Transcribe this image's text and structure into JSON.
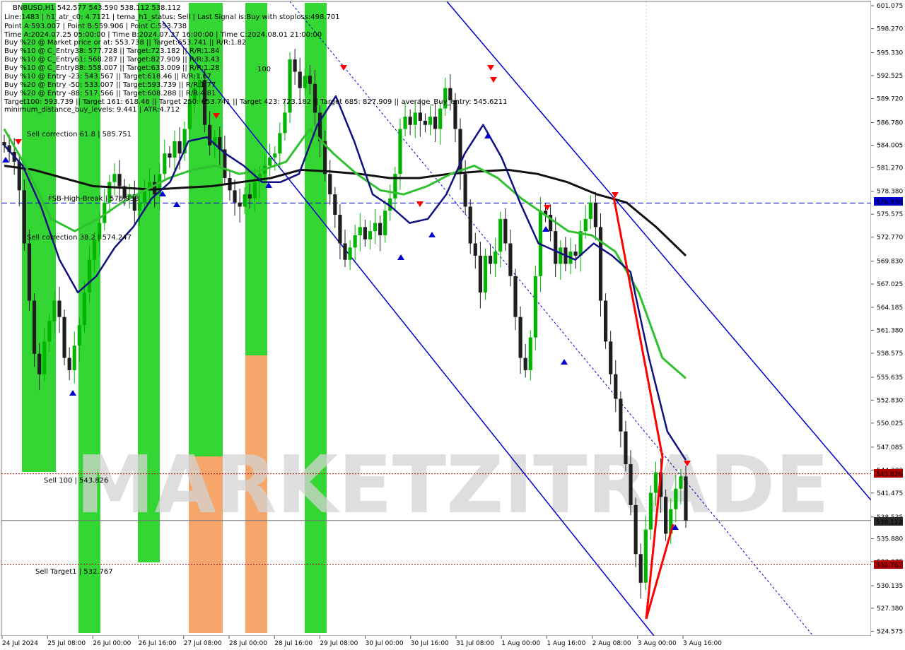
{
  "header": {
    "line1": "BNBUSD,H1  542.577 543.590 538.112 538.112",
    "line2": "Line:1483 | h1_atr_c0: 4.7121 | tema_h1_status: Sell | Last Signal is:Buy with stoploss:498.701",
    "line3": "Point A:593.007 | Point B:559.906 | Point C:553.738",
    "line4": "Time A:2024.07.25 05:00:00 | Time B:2024.07.27 16:00:00 | Time C:2024.08.01 21:00:00",
    "line5": "Buy %20 @ Market price or at: 553.738 || Target:653.741 || R/R:1.82",
    "line6": "Buy %10 @ C_Entry38: 577.728 || Target:723.182 || R/R:1.84",
    "line7": "Buy %10 @ C_Entry61: 568.287 || Target:827.909 || R/R:3.43",
    "line8": "Buy %10 @ C_Entry88: 558.007 || Target:633.009 || R/R:1.28",
    "line9": "Buy %10 @ Entry -23: 543.567 || Target:618.46 || R/R:1.67",
    "line10": "Buy %20 @ Entry -50: 533.007 || Target:593.739 || R/R:1.77",
    "line11": "Buy %20 @ Entry -88: 517.566 || Target:608.288 || R/R:4.81",
    "line12": "Target100: 593.739 || Target 161: 618.46 || Target 250: 653.741 || Target 423: 723.182 || Target 685: 827.909 || average_Buy_entry: 545.6211",
    "line13": "minimum_distance_buy_levels: 9.441 | ATR:4.712"
  },
  "labels": {
    "sell_correction_618": "Sell correction 61.8 | 585.751",
    "sell_correction_382": "Sell correction 38.2 | 574.247",
    "fsb_high": "FSB-High-Break | 576.938",
    "sell_100": "Sell 100 | 543.826",
    "sell_target1": "Sell Target1 | 532.767",
    "marker_100": "100",
    "watermark": "MARKETZITRADE"
  },
  "price_badges": {
    "fsb": "576.938",
    "sell100": "543.826",
    "current": "538.112",
    "target": "532.767"
  },
  "colors": {
    "up_bar": "#00b400",
    "down_bar": "#1e1e1e",
    "green_band": "#33d633",
    "orange_band": "#f5a66a",
    "blue_line": "#0000d0",
    "ma_navy": "#101080",
    "ma_green": "#30c030",
    "ma_black": "#101010",
    "red_line": "#ff0000",
    "dashed_red": "#b00000",
    "orange_dash": "#ff7f27"
  },
  "chart_data": {
    "type": "candlestick",
    "symbol": "BNBUSD",
    "timeframe": "H1",
    "y_axis": {
      "range": [
        524.0,
        601.6
      ],
      "ticks": [
        "601.075",
        "598.270",
        "595.330",
        "592.525",
        "589.720",
        "586.780",
        "584.005",
        "581.270",
        "578.380",
        "575.575",
        "572.770",
        "569.830",
        "567.025",
        "564.185",
        "561.380",
        "558.575",
        "555.635",
        "552.830",
        "550.025",
        "547.085",
        "544.280",
        "541.475",
        "538.535",
        "535.880",
        "533.075",
        "530.135",
        "527.380",
        "524.575"
      ]
    },
    "x_axis": {
      "labels": [
        "24 Jul 2024",
        "25 Jul 08:00",
        "26 Jul 00:00",
        "26 Jul 16:00",
        "27 Jul 08:00",
        "28 Jul 00:00",
        "28 Jul 16:00",
        "29 Jul 08:00",
        "30 Jul 00:00",
        "30 Jul 16:00",
        "31 Jul 08:00",
        "1 Aug 00:00",
        "1 Aug 16:00",
        "2 Aug 08:00",
        "3 Aug 00:00",
        "3 Aug 16:00"
      ]
    },
    "levels": [
      {
        "name": "FSB-High-Break",
        "value": 576.938,
        "style": "dashed-blue"
      },
      {
        "name": "Sell 100",
        "value": 543.826,
        "style": "dotted-red"
      },
      {
        "name": "Current",
        "value": 538.112,
        "style": "solid-gray"
      },
      {
        "name": "Sell Target1",
        "value": 532.767,
        "style": "dotted-red"
      }
    ],
    "close_path": [
      584.0,
      583.2,
      582.0,
      578.5,
      572.0,
      565.0,
      558.5,
      556.0,
      560.0,
      562.5,
      565.0,
      563.0,
      558.0,
      556.5,
      559.5,
      562.0,
      566.0,
      570.0,
      572.5,
      574.5,
      577.0,
      579.5,
      580.5,
      579.0,
      577.5,
      578.0,
      576.0,
      577.0,
      578.5,
      579.5,
      578.0,
      580.5,
      583.0,
      582.5,
      584.5,
      583.0,
      586.0,
      589.5,
      591.0,
      592.0,
      586.5,
      584.0,
      585.0,
      583.5,
      580.0,
      578.5,
      577.0,
      576.5,
      578.0,
      577.5,
      579.5,
      580.5,
      581.5,
      582.5,
      583.0,
      585.5,
      588.0,
      594.5,
      593.0,
      591.0,
      592.5,
      591.5,
      588.0,
      584.5,
      580.5,
      578.0,
      575.5,
      572.0,
      570.0,
      571.5,
      573.0,
      574.0,
      572.5,
      573.5,
      574.5,
      573.0,
      576.0,
      577.5,
      580.5,
      586.0,
      587.5,
      586.5,
      588.0,
      587.0,
      586.5,
      587.5,
      586.0,
      588.5,
      591.0,
      589.5,
      586.0,
      580.5,
      576.5,
      572.0,
      570.5,
      566.0,
      570.5,
      569.5,
      571.0,
      575.0,
      572.0,
      568.0,
      563.0,
      558.0,
      556.5,
      560.5,
      568.0,
      576.0,
      575.5,
      573.5,
      569.5,
      571.5,
      569.5,
      571.0,
      570.5,
      573.5,
      575.0,
      577.0,
      574.0,
      565.0,
      560.0,
      556.0,
      553.0,
      549.0,
      545.0,
      540.0,
      534.0,
      530.5,
      537.0,
      541.5,
      544.0,
      541.0,
      536.5,
      539.5,
      542.0,
      543.5,
      538.112
    ],
    "ma_navy": [
      584.0,
      581.5,
      576.5,
      570.0,
      566.0,
      568.0,
      571.5,
      574.0,
      577.5,
      579.5,
      584.5,
      585.0,
      583.0,
      581.5,
      579.5,
      579.5,
      580.5,
      586.5,
      590.0,
      584.5,
      578.0,
      576.5,
      574.5,
      575.0,
      578.0,
      583.0,
      586.5,
      582.5,
      577.0,
      572.0,
      571.0,
      570.0,
      572.0,
      570.5,
      568.5,
      558.0,
      549.0,
      545.5
    ],
    "ma_green": [
      586.0,
      581.0,
      575.0,
      573.5,
      575.0,
      577.0,
      578.5,
      580.0,
      581.0,
      581.5,
      580.5,
      581.0,
      582.0,
      586.0,
      583.0,
      580.5,
      578.5,
      578.0,
      579.0,
      580.5,
      581.5,
      580.0,
      577.5,
      575.5,
      573.5,
      573.0,
      571.0,
      566.0,
      558.0,
      555.5
    ],
    "ma_black": [
      581.5,
      581.0,
      580.0,
      579.0,
      578.8,
      578.6,
      578.8,
      579.0,
      579.5,
      580.0,
      581.0,
      580.8,
      580.5,
      580.0,
      580.0,
      580.5,
      580.8,
      581.0,
      580.5,
      579.5,
      578.0,
      577.0,
      574.0,
      570.5
    ],
    "info_text": "BNBUSD,H1 542.577 543.590 538.112 538.112"
  }
}
